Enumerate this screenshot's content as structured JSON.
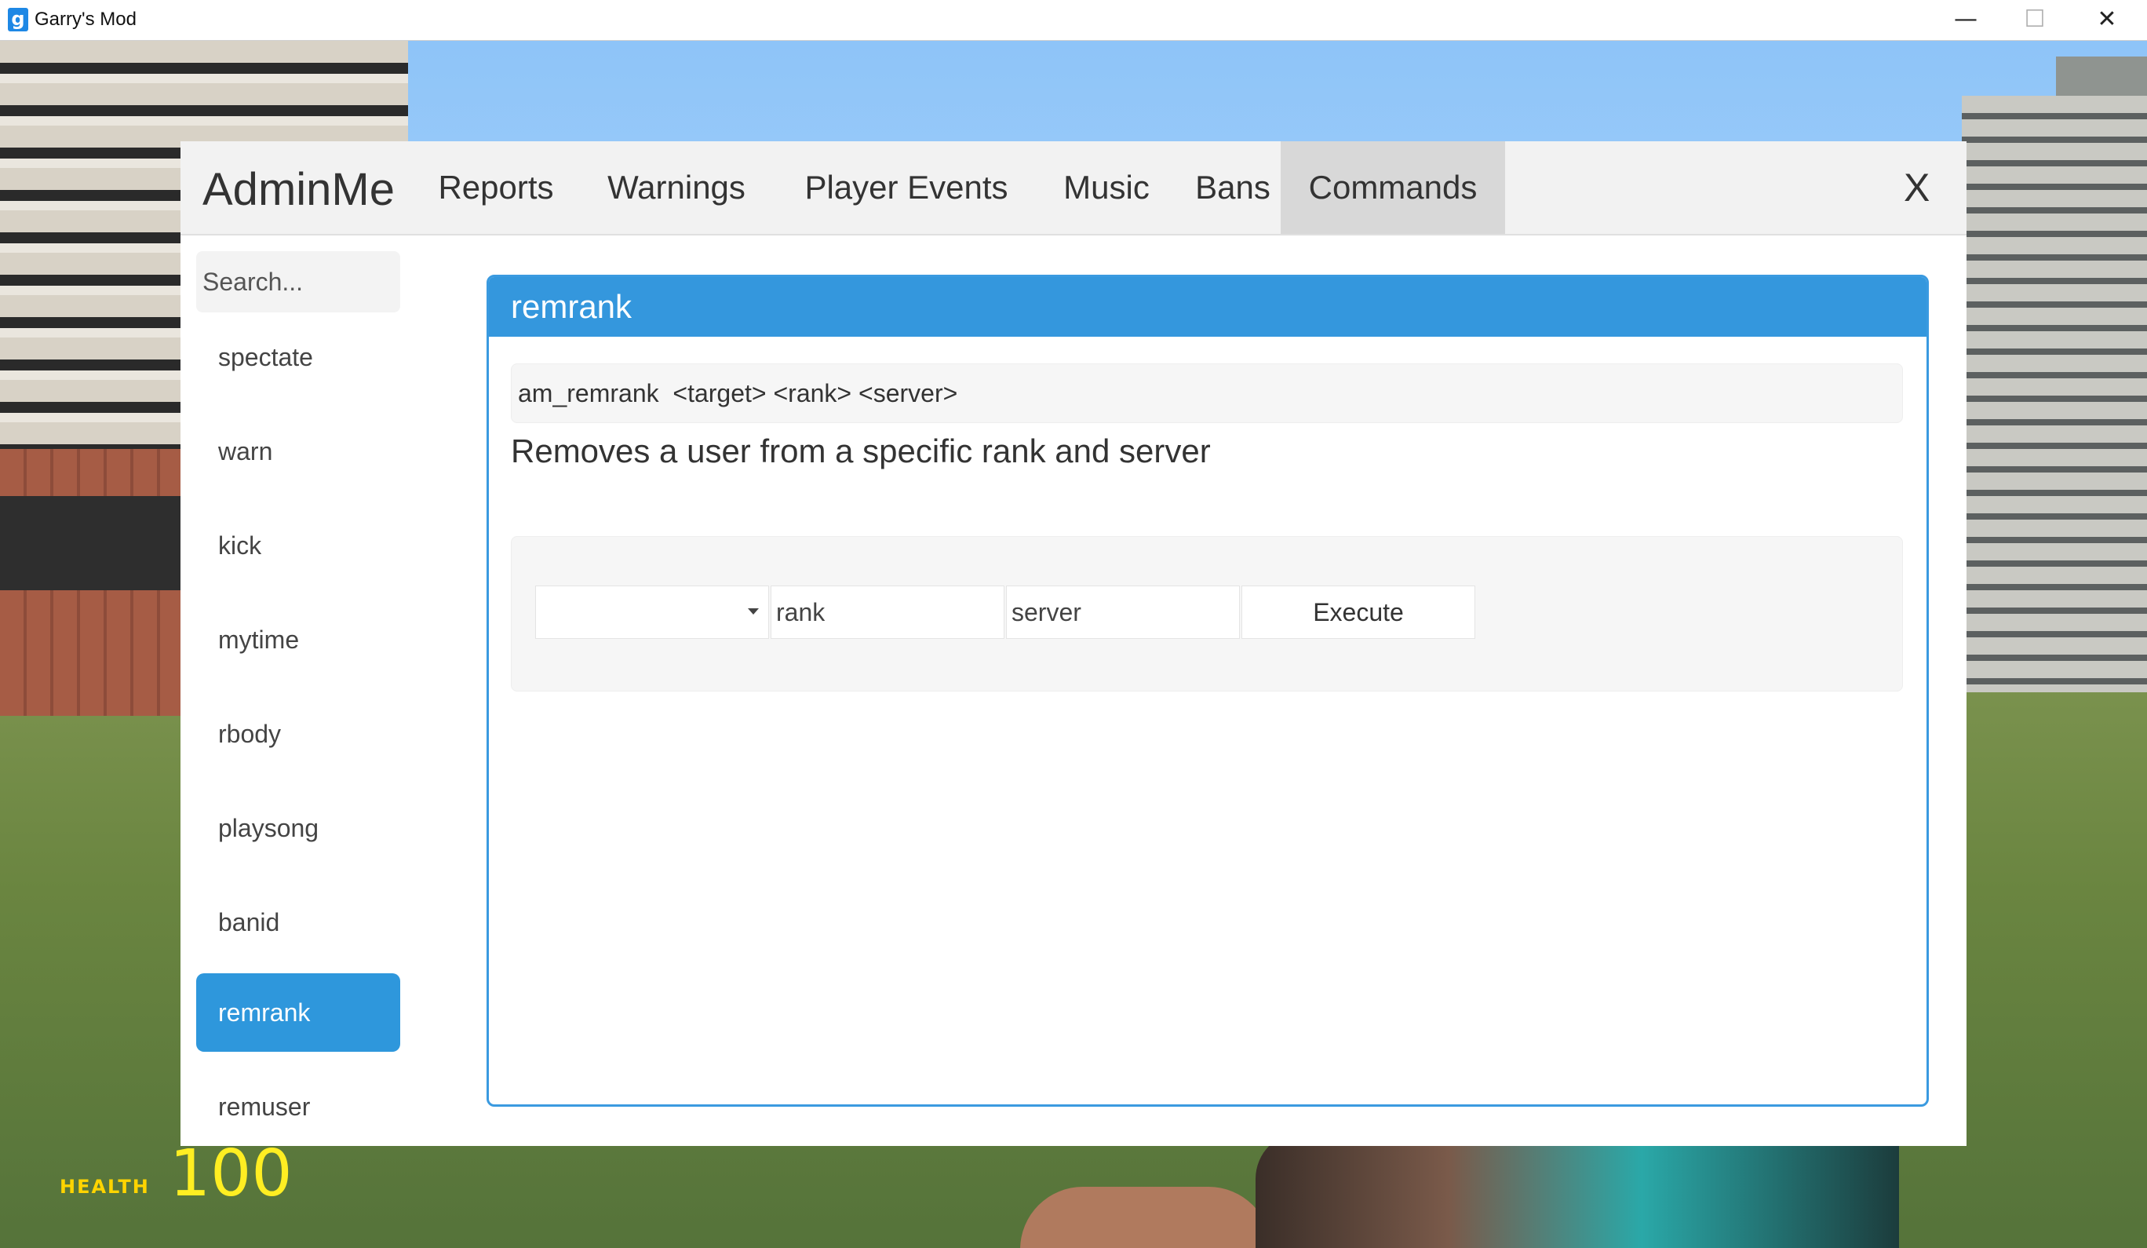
{
  "window": {
    "title": "Garry's Mod",
    "icon_letter": "g",
    "controls": {
      "minimize": "—",
      "maximize": "☐",
      "close": "✕"
    }
  },
  "hud": {
    "health_label": "HEALTH",
    "health_value": "100"
  },
  "admin": {
    "brand": "AdminMe",
    "nav": [
      {
        "label": "Reports"
      },
      {
        "label": "Warnings"
      },
      {
        "label": "Player Events"
      },
      {
        "label": "Music"
      },
      {
        "label": "Bans"
      },
      {
        "label": "Commands",
        "active": true
      }
    ],
    "close_label": "X",
    "search": {
      "placeholder": "Search..."
    },
    "commands": [
      "spectate",
      "warn",
      "kick",
      "mytime",
      "rbody",
      "playsong",
      "banid",
      "remrank",
      "remuser"
    ],
    "selected_command": "remrank",
    "detail": {
      "title": "remrank",
      "usage": "am_remrank  <target> <rank> <server>",
      "description": "Removes a user from a specific rank and server",
      "target_value": "",
      "rank_value": "rank",
      "server_value": "server",
      "execute_label": "Execute"
    }
  },
  "colors": {
    "accent": "#3497dd",
    "active_tab_bg": "#d8d8d8",
    "hud_yellow": "#ffd400"
  }
}
